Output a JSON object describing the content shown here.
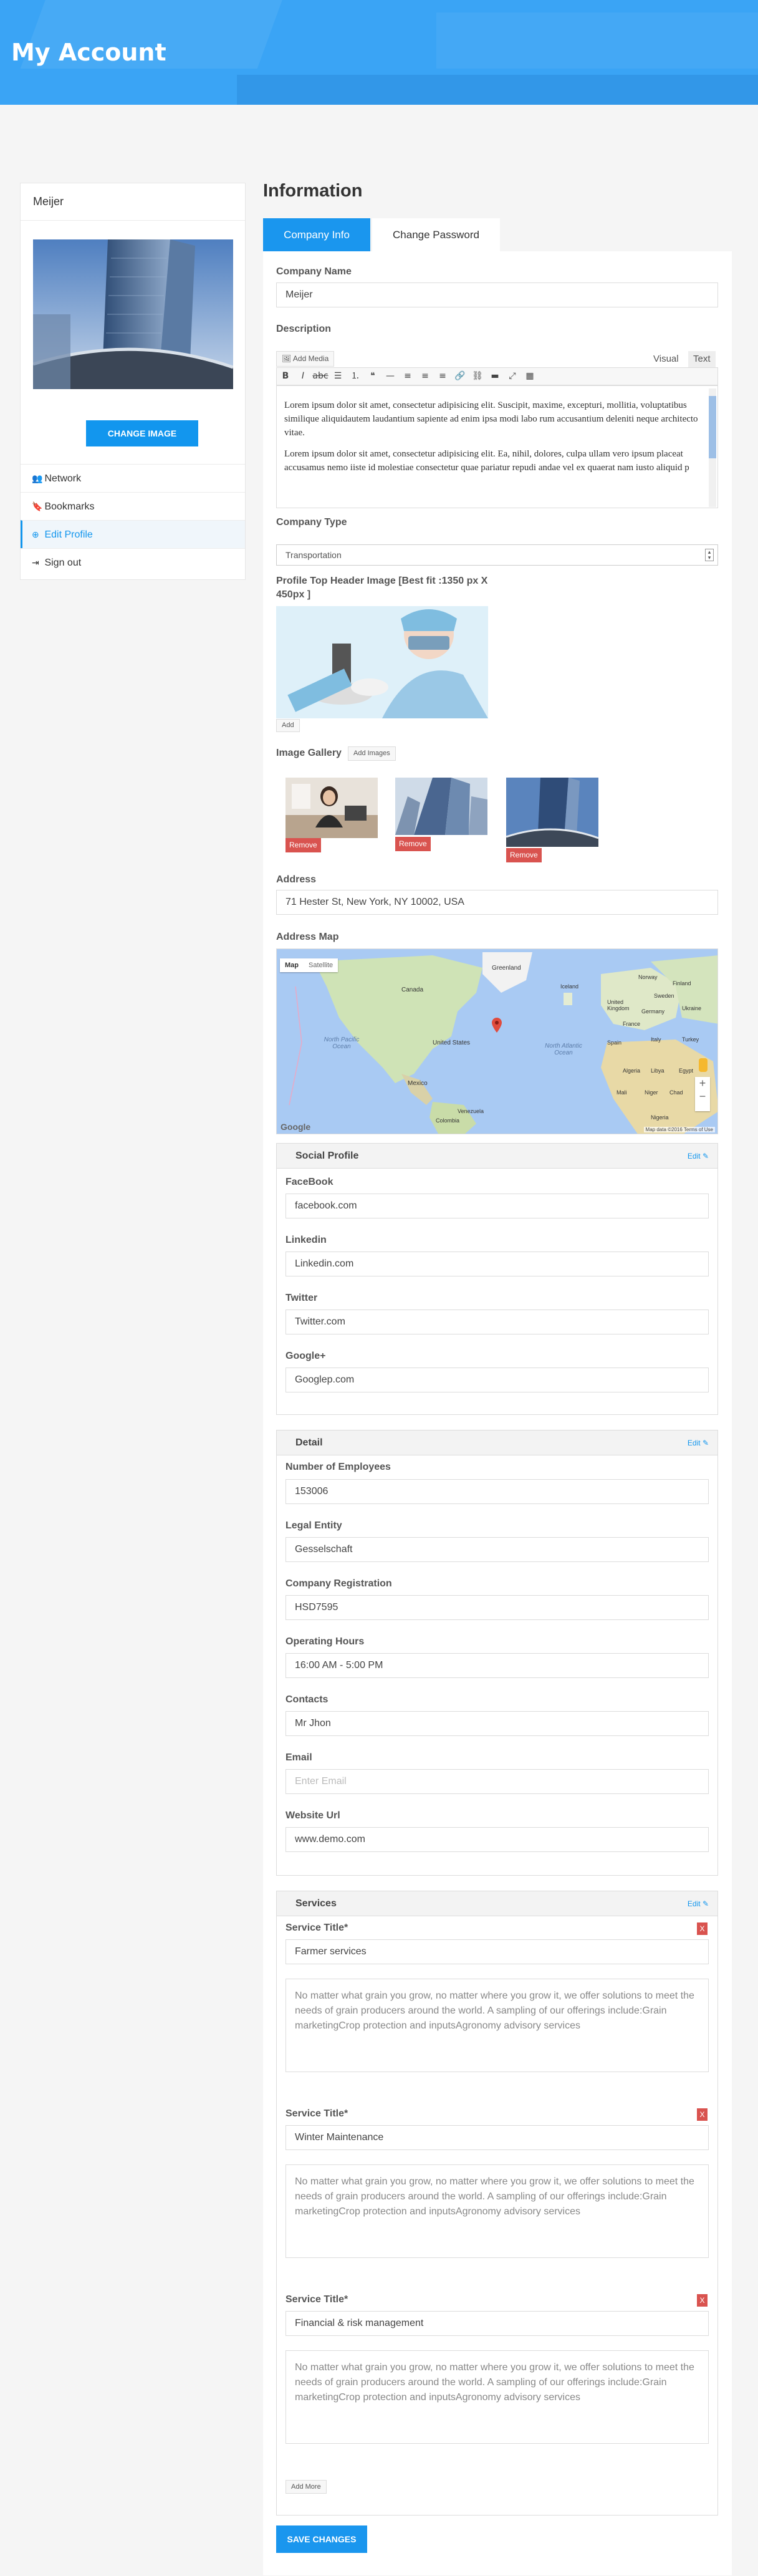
{
  "page": {
    "title": "My Account"
  },
  "sidebar": {
    "user_name": "Meijer",
    "change_image_label": "CHANGE IMAGE",
    "menu": [
      {
        "label": "Network",
        "icon": "users-icon"
      },
      {
        "label": "Bookmarks",
        "icon": "bookmark-icon"
      },
      {
        "label": "Edit Profile",
        "icon": "plus-circle-icon",
        "active": true
      },
      {
        "label": "Sign out",
        "icon": "sign-out-icon"
      }
    ]
  },
  "main": {
    "title": "Information",
    "tabs": [
      {
        "label": "Company Info",
        "active": true
      },
      {
        "label": "Change Password"
      }
    ]
  },
  "form": {
    "company_name": {
      "label": "Company Name",
      "value": "Meijer"
    },
    "description": {
      "label": "Description",
      "add_media": "Add Media",
      "visual": "Visual",
      "text": "Text",
      "paragraphs": [
        "Lorem ipsum dolor sit amet, consectetur adipisicing elit. Suscipit, maxime, excepturi, mollitia, voluptatibus similique aliquidautem laudantium sapiente ad enim ipsa modi labo rum accusantium deleniti neque architecto vitae.",
        "Lorem ipsum dolor sit amet, consectetur adipisicing elit. Ea, nihil, dolores, culpa ullam vero ipsum placeat accusamus nemo iiste id molestiae consectetur quae pariatur repudi andae vel ex quaerat nam iusto aliquid p"
      ]
    },
    "company_type": {
      "label": "Company Type",
      "value": "Transportation"
    },
    "header_image": {
      "label": "Profile Top Header Image [Best fit :1350 px X 450px ]",
      "add_label": "Add"
    },
    "gallery": {
      "label": "Image Gallery",
      "add_images": "Add Images",
      "remove_label": "Remove"
    },
    "address": {
      "label": "Address",
      "value": "71 Hester St, New York, NY 10002, USA"
    },
    "address_map": {
      "label": "Address Map",
      "map_tab": "Map",
      "satellite_tab": "Satellite",
      "labels": [
        "North Pacific Ocean",
        "North Atlantic Ocean",
        "Canada",
        "United States",
        "Mexico",
        "Greenland",
        "Iceland",
        "Algeria",
        "Libya",
        "Egypt",
        "Mali",
        "Niger",
        "Chad",
        "Finland",
        "Norway",
        "Sweden",
        "United Kingdom",
        "Germany",
        "Ukraine",
        "France",
        "Spain",
        "Italy",
        "Turkey",
        "Venezuela",
        "Colombia",
        "Nigeria"
      ],
      "attribution": "Map data ©2016 Terms of Use",
      "google": "Google"
    },
    "social": {
      "title": "Social Profile",
      "edit_label": "Edit",
      "fields": [
        {
          "label": "FaceBook",
          "value": "facebook.com"
        },
        {
          "label": "Linkedin",
          "value": "Linkedin.com"
        },
        {
          "label": "Twitter",
          "value": "Twitter.com"
        },
        {
          "label": "Google+",
          "value": "Googlep.com"
        }
      ]
    },
    "detail": {
      "title": "Detail",
      "edit_label": "Edit",
      "fields": [
        {
          "label": "Number of Employees",
          "value": "153006"
        },
        {
          "label": "Legal Entity",
          "value": "Gesselschaft"
        },
        {
          "label": "Company Registration",
          "value": "HSD7595"
        },
        {
          "label": "Operating Hours",
          "value": "16:00 AM - 5:00 PM"
        },
        {
          "label": "Contacts",
          "value": "Mr Jhon"
        },
        {
          "label": "Email",
          "value": "",
          "placeholder": "Enter Email"
        },
        {
          "label": "Website Url",
          "value": "www.demo.com"
        }
      ]
    },
    "services": {
      "title": "Services",
      "edit_label": "Edit",
      "service_title_label": "Service Title*",
      "x_label": "X",
      "items": [
        {
          "title": "Farmer services",
          "description": "No matter what grain you grow, no matter where you grow it, we offer solutions to meet the needs of grain producers around the world. A sampling of our offerings include:Grain marketingCrop protection and inputsAgronomy advisory services"
        },
        {
          "title": "Winter Maintenance",
          "description": "No matter what grain you grow, no matter where you grow it, we offer solutions to meet the needs of grain producers around the world. A sampling of our offerings include:Grain marketingCrop protection and inputsAgronomy advisory services"
        },
        {
          "title": "Financial & risk management",
          "description": "No matter what grain you grow, no matter where you grow it, we offer solutions to meet the needs of grain producers around the world. A sampling of our offerings include:Grain marketingCrop protection and inputsAgronomy advisory services"
        }
      ],
      "add_more": "Add More"
    },
    "save_label": "SAVE CHANGES"
  },
  "colors": {
    "accent": "#1a96ee",
    "banner": "#3aa4f5",
    "danger": "#d9534f"
  }
}
